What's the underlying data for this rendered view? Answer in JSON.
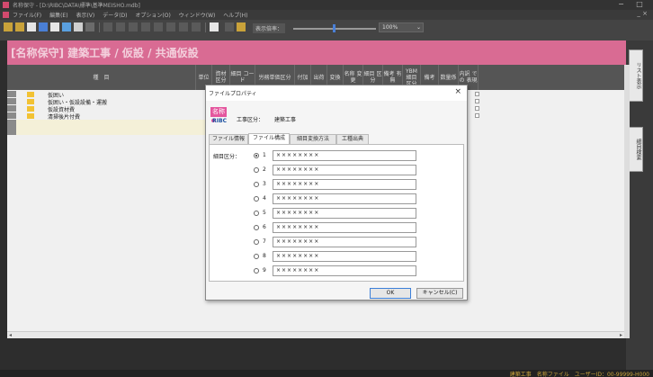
{
  "titlebar": {
    "title": "名称保守 - [D:\\RIBC\\DATA\\標準\\基準MEISHO.mdb]",
    "min": "−",
    "max": "□"
  },
  "menubar": {
    "items": [
      "ファイル(F)",
      "編集(E)",
      "表示(V)",
      "データ(D)",
      "オプション(O)",
      "ウィンドウ(W)",
      "ヘルプ(H)"
    ],
    "mdi": "_ ×"
  },
  "toolbar": {
    "zoom_label": "表示倍率：",
    "zoom_value": "100%",
    "zoom_fraction": 0.48,
    "dropdown_arrow": "⌄"
  },
  "header": {
    "title": "[名称保守] 建築工事 / 仮設 / 共通仮設"
  },
  "grid": {
    "columns": [
      "種　目",
      "単位",
      "資材\n区分",
      "細目\nコード",
      "労務単価区分",
      "付加",
      "出荷",
      "変換",
      "名称\n変更",
      "細目\n区分",
      "備考\n有無",
      "YBM\n細目\n区分",
      "備考",
      "数量係",
      "内訳\nでの\n表現"
    ],
    "rows": [
      {
        "label": "仮囲い"
      },
      {
        "label": "仮囲い・仮設設備・運搬"
      },
      {
        "label": "仮設資材費"
      },
      {
        "label": "清掃後片付費"
      }
    ]
  },
  "right_tabs": [
    "リスト表示",
    "細目検索"
  ],
  "status": {
    "text": "建築工事　名称ファイル　ユーザーID：00-99999-H000"
  },
  "dialog": {
    "title": "ファイルプロパティ",
    "close": "×",
    "logo_top": "名称",
    "logo_bottom": "RIBC",
    "kubun_label": "工事区分：",
    "kubun_value": "建築工事",
    "tabs": [
      "ファイル情報",
      "ファイル構成",
      "細目変換方法",
      "工種出典"
    ],
    "active_tab": "ファイル構成",
    "radio_label": "細目区分：",
    "options": [
      {
        "num": "1",
        "value": "××××××××",
        "selected": true
      },
      {
        "num": "2",
        "value": "××××××××",
        "selected": false
      },
      {
        "num": "3",
        "value": "××××××××",
        "selected": false
      },
      {
        "num": "4",
        "value": "××××××××",
        "selected": false
      },
      {
        "num": "5",
        "value": "××××××××",
        "selected": false
      },
      {
        "num": "6",
        "value": "××××××××",
        "selected": false
      },
      {
        "num": "7",
        "value": "××××××××",
        "selected": false
      },
      {
        "num": "8",
        "value": "××××××××",
        "selected": false
      },
      {
        "num": "9",
        "value": "××××××××",
        "selected": false
      }
    ],
    "ok": "OK",
    "cancel": "キャンセル(C)"
  }
}
